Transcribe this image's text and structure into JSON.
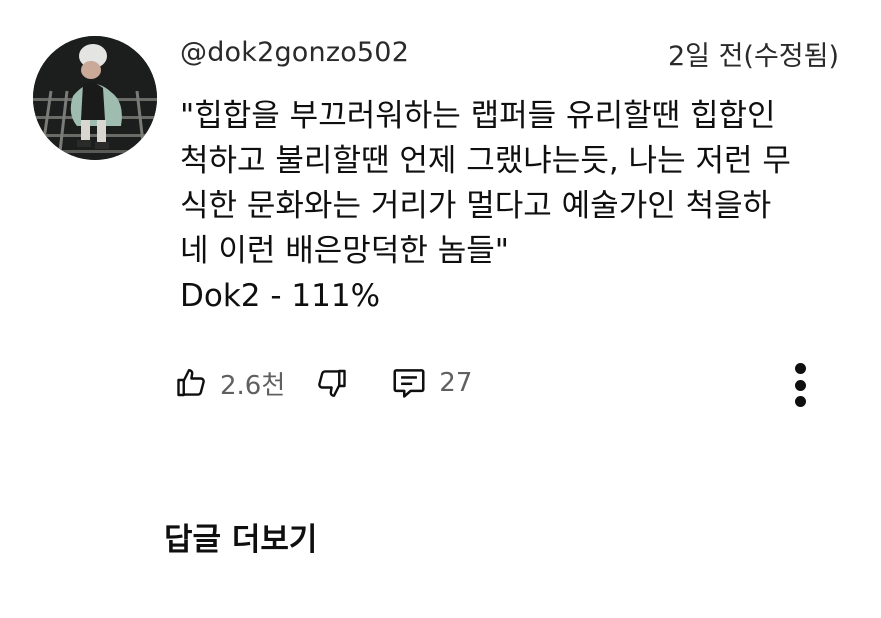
{
  "comment": {
    "author": "@dok2gonzo502",
    "timestamp": "2일 전(수정됨)",
    "text_lines": [
      "\"힙합을 부끄러워하는 랩퍼들 유리할땐 힙합인",
      "척하고 불리할땐 언제 그랬냐는듯, 나는 저런 무",
      "식한 문화와는 거리가 멀다고 예술가인 척을하",
      "네 이런 배은망덕한 놈들\"",
      "Dok2   -  111%"
    ]
  },
  "actions": {
    "like_count": "2.6천",
    "reply_count": "27"
  },
  "replies": {
    "label": "답글 더보기"
  },
  "icons": {
    "like": "thumbs-up-icon",
    "dislike": "thumbs-down-icon",
    "reply": "comment-icon",
    "more": "more-vert-icon"
  }
}
